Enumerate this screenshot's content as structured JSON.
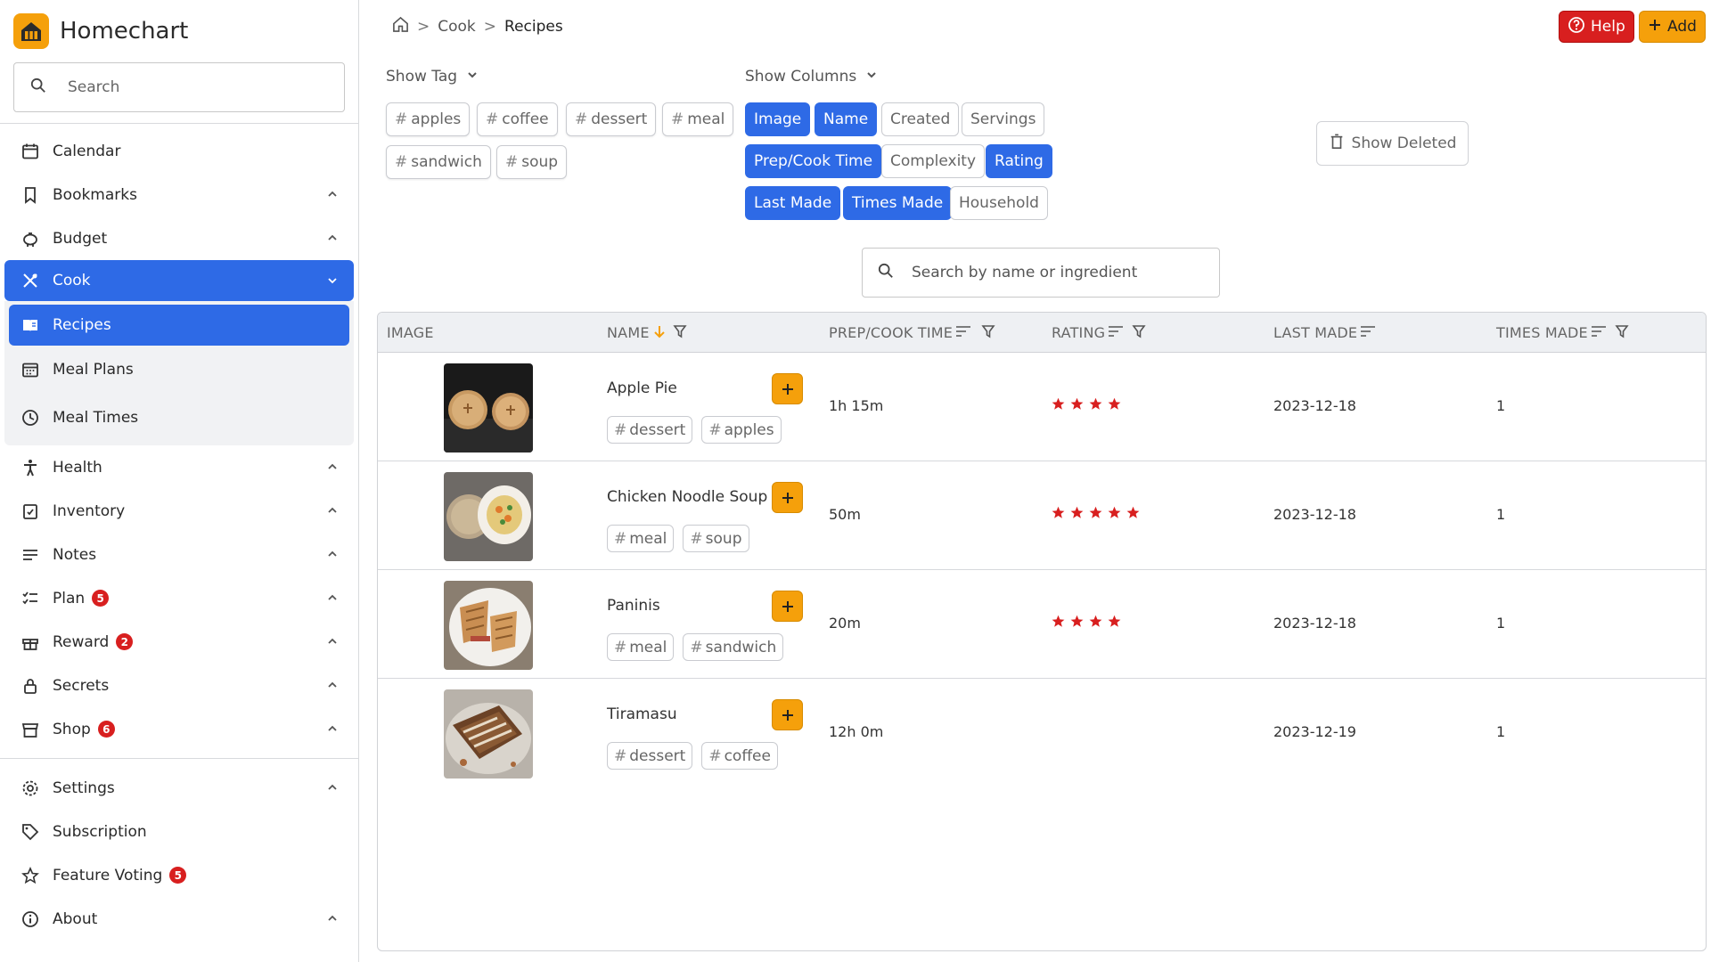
{
  "app": {
    "name": "Homechart"
  },
  "sidebar": {
    "search_placeholder": "Search",
    "items": [
      {
        "label": "Calendar",
        "icon": "calendar-icon",
        "chevron": false
      },
      {
        "label": "Bookmarks",
        "icon": "bookmark-icon",
        "chevron": true
      },
      {
        "label": "Budget",
        "icon": "piggy-bank-icon",
        "chevron": true
      },
      {
        "label": "Cook",
        "icon": "utensils-icon",
        "chevron": true,
        "active": true
      },
      {
        "label": "Health",
        "icon": "person-icon",
        "chevron": true
      },
      {
        "label": "Inventory",
        "icon": "inventory-icon",
        "chevron": true
      },
      {
        "label": "Notes",
        "icon": "notes-icon",
        "chevron": true
      },
      {
        "label": "Plan",
        "icon": "checklist-icon",
        "chevron": true,
        "badge": "5"
      },
      {
        "label": "Reward",
        "icon": "gift-icon",
        "chevron": true,
        "badge": "2"
      },
      {
        "label": "Secrets",
        "icon": "lock-icon",
        "chevron": true
      },
      {
        "label": "Shop",
        "icon": "store-icon",
        "chevron": true,
        "badge": "6"
      },
      {
        "label": "Settings",
        "icon": "gear-icon",
        "chevron": true
      },
      {
        "label": "Subscription",
        "icon": "tag-icon",
        "chevron": false
      },
      {
        "label": "Feature Voting",
        "icon": "star-icon",
        "chevron": false,
        "badge": "5"
      },
      {
        "label": "About",
        "icon": "info-icon",
        "chevron": true
      }
    ],
    "cook_sub": [
      {
        "label": "Recipes",
        "icon": "book-icon",
        "active": true
      },
      {
        "label": "Meal Plans",
        "icon": "calendar-icon"
      },
      {
        "label": "Meal Times",
        "icon": "clock-icon"
      }
    ]
  },
  "header": {
    "breadcrumb": [
      "Cook",
      "Recipes"
    ],
    "help_label": "Help",
    "add_label": "Add"
  },
  "filters": {
    "show_tag_label": "Show Tag",
    "tags": [
      "apples",
      "coffee",
      "dessert",
      "meal",
      "sandwich",
      "soup"
    ],
    "show_columns_label": "Show Columns",
    "columns": [
      {
        "label": "Image",
        "on": true
      },
      {
        "label": "Name",
        "on": true
      },
      {
        "label": "Created",
        "on": false
      },
      {
        "label": "Servings",
        "on": false
      },
      {
        "label": "Prep/Cook Time",
        "on": true
      },
      {
        "label": "Complexity",
        "on": false
      },
      {
        "label": "Rating",
        "on": true
      },
      {
        "label": "Last Made",
        "on": true
      },
      {
        "label": "Times Made",
        "on": true
      },
      {
        "label": "Household",
        "on": false
      }
    ],
    "show_deleted_label": "Show Deleted",
    "search_placeholder": "Search by name or ingredient"
  },
  "table": {
    "headers": [
      "IMAGE",
      "NAME",
      "PREP/COOK TIME",
      "RATING",
      "LAST MADE",
      "TIMES MADE"
    ],
    "rows": [
      {
        "name": "Apple Pie",
        "tags": [
          "dessert",
          "apples"
        ],
        "time": "1h 15m",
        "rating": 4,
        "last_made": "2023-12-18",
        "times_made": "1"
      },
      {
        "name": "Chicken Noodle Soup",
        "tags": [
          "meal",
          "soup"
        ],
        "time": "50m",
        "rating": 5,
        "last_made": "2023-12-18",
        "times_made": "1"
      },
      {
        "name": "Paninis",
        "tags": [
          "meal",
          "sandwich"
        ],
        "time": "20m",
        "rating": 4,
        "last_made": "2023-12-18",
        "times_made": "1"
      },
      {
        "name": "Tiramasu",
        "tags": [
          "dessert",
          "coffee"
        ],
        "time": "12h 0m",
        "rating": 0,
        "last_made": "2023-12-19",
        "times_made": "1"
      }
    ]
  },
  "colors": {
    "accent": "#2e6ae6",
    "brand": "#f5a00b",
    "danger": "#d81f1f"
  }
}
